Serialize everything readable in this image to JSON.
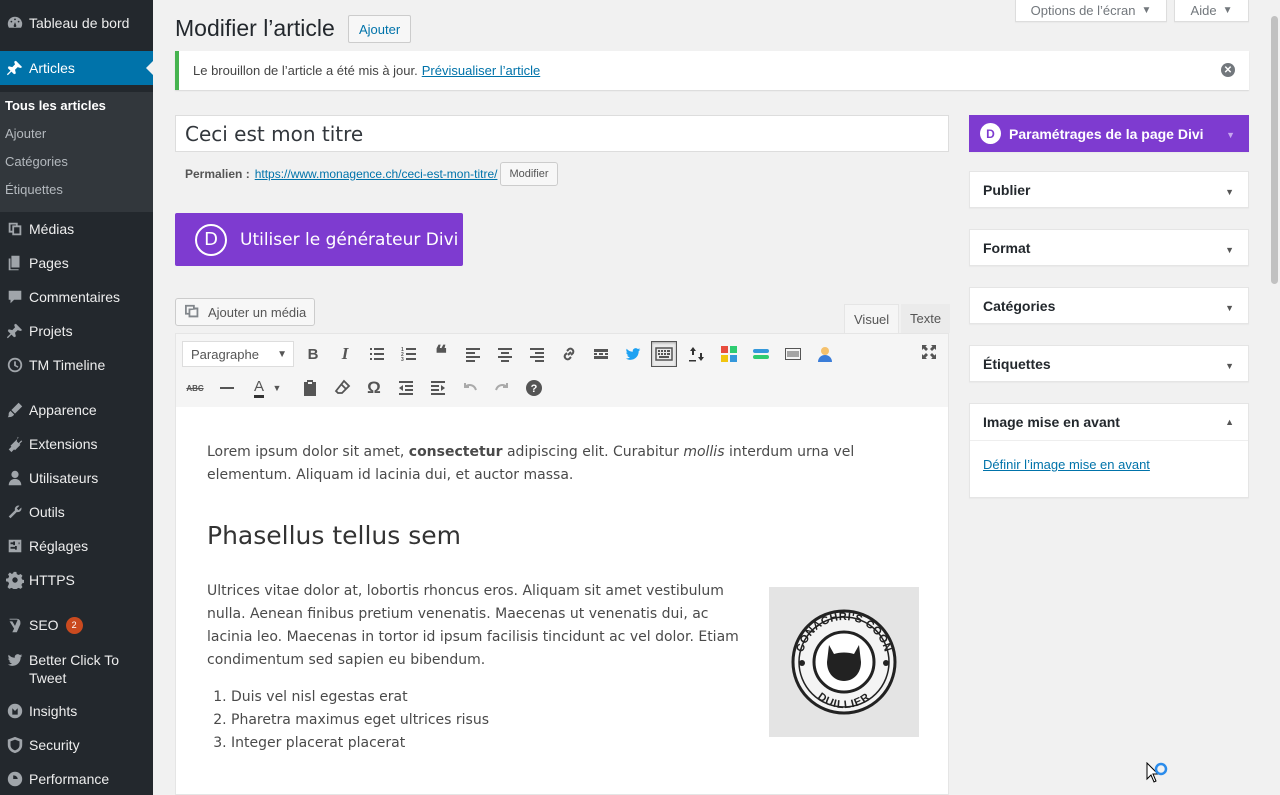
{
  "sidebar": {
    "items": [
      {
        "label": "Tableau de bord",
        "icon": "dashboard-icon"
      },
      {
        "label": "Articles",
        "icon": "pushpin-icon"
      },
      {
        "label": "Médias",
        "icon": "media-icon"
      },
      {
        "label": "Pages",
        "icon": "pages-icon"
      },
      {
        "label": "Commentaires",
        "icon": "comments-icon"
      },
      {
        "label": "Projets",
        "icon": "pushpin-icon"
      },
      {
        "label": "TM Timeline",
        "icon": "clock-icon"
      },
      {
        "label": "Apparence",
        "icon": "brush-icon"
      },
      {
        "label": "Extensions",
        "icon": "plugin-icon"
      },
      {
        "label": "Utilisateurs",
        "icon": "users-icon"
      },
      {
        "label": "Outils",
        "icon": "wrench-icon"
      },
      {
        "label": "Réglages",
        "icon": "settings-icon"
      },
      {
        "label": "HTTPS",
        "icon": "gear-icon"
      },
      {
        "label": "SEO",
        "icon": "yoast-icon",
        "badge": "2"
      },
      {
        "label": "Better Click To Tweet",
        "icon": "twitter-icon"
      },
      {
        "label": "Insights",
        "icon": "insights-icon"
      },
      {
        "label": "Security",
        "icon": "shield-icon"
      },
      {
        "label": "Performance",
        "icon": "performance-icon"
      }
    ],
    "submenu": [
      "Tous les articles",
      "Ajouter",
      "Catégories",
      "Étiquettes"
    ]
  },
  "top_buttons": {
    "screen_options": "Options de l’écran",
    "help": "Aide"
  },
  "header": {
    "title": "Modifier l’article",
    "add_button": "Ajouter"
  },
  "notice": {
    "text": "Le brouillon de l’article a été mis à jour.",
    "link": "Prévisualiser l’article"
  },
  "post": {
    "title": "Ceci est mon titre",
    "permalink_label": "Permalien :",
    "permalink_url": "https://www.monagence.ch/ceci-est-mon-titre/",
    "permalink_edit": "Modifier"
  },
  "divi": {
    "builder_button": "Utiliser le générateur Divi",
    "logo": "D"
  },
  "editor": {
    "media_button": "Ajouter un média",
    "tab_visual": "Visuel",
    "tab_text": "Texte",
    "format": "Paragraphe"
  },
  "content": {
    "p1_a": "Lorem ipsum dolor sit amet, ",
    "p1_bold": "consectetur",
    "p1_b": " adipiscing elit. Curabitur ",
    "p1_italic": "mollis",
    "p1_c": " interdum urna vel elementum. Aliquam id lacinia dui, et auctor massa.",
    "heading": "Phasellus tellus sem",
    "p2": "Ultrices vitae dolor at, lobortis rhoncus eros. Aliquam sit amet vestibulum nulla. Aenean finibus pretium venenatis. Maecenas ut venenatis dui, ac lacinia leo. Maecenas in tortor id ipsum facilisis tincidunt ac vel dolor. Etiam condimentum sed sapien eu bibendum.",
    "list": [
      "Duis vel nisl egestas erat",
      "Pharetra maximus eget ultrices risus",
      "Integer placerat placerat"
    ],
    "logo_top": "CONACHRI'S COON",
    "logo_bottom": "DUILLIER"
  },
  "postboxes": {
    "divi_settings": "Paramétrages de la page Divi",
    "publish": "Publier",
    "format": "Format",
    "categories": "Catégories",
    "tags": "Étiquettes",
    "featured_image": "Image mise en avant",
    "featured_link": "Définir l’image mise en avant"
  },
  "colors": {
    "sidebar_bg": "#23282d",
    "accent": "#0073aa",
    "divi_purple": "#7e3bd0",
    "notice_success": "#46b450"
  }
}
